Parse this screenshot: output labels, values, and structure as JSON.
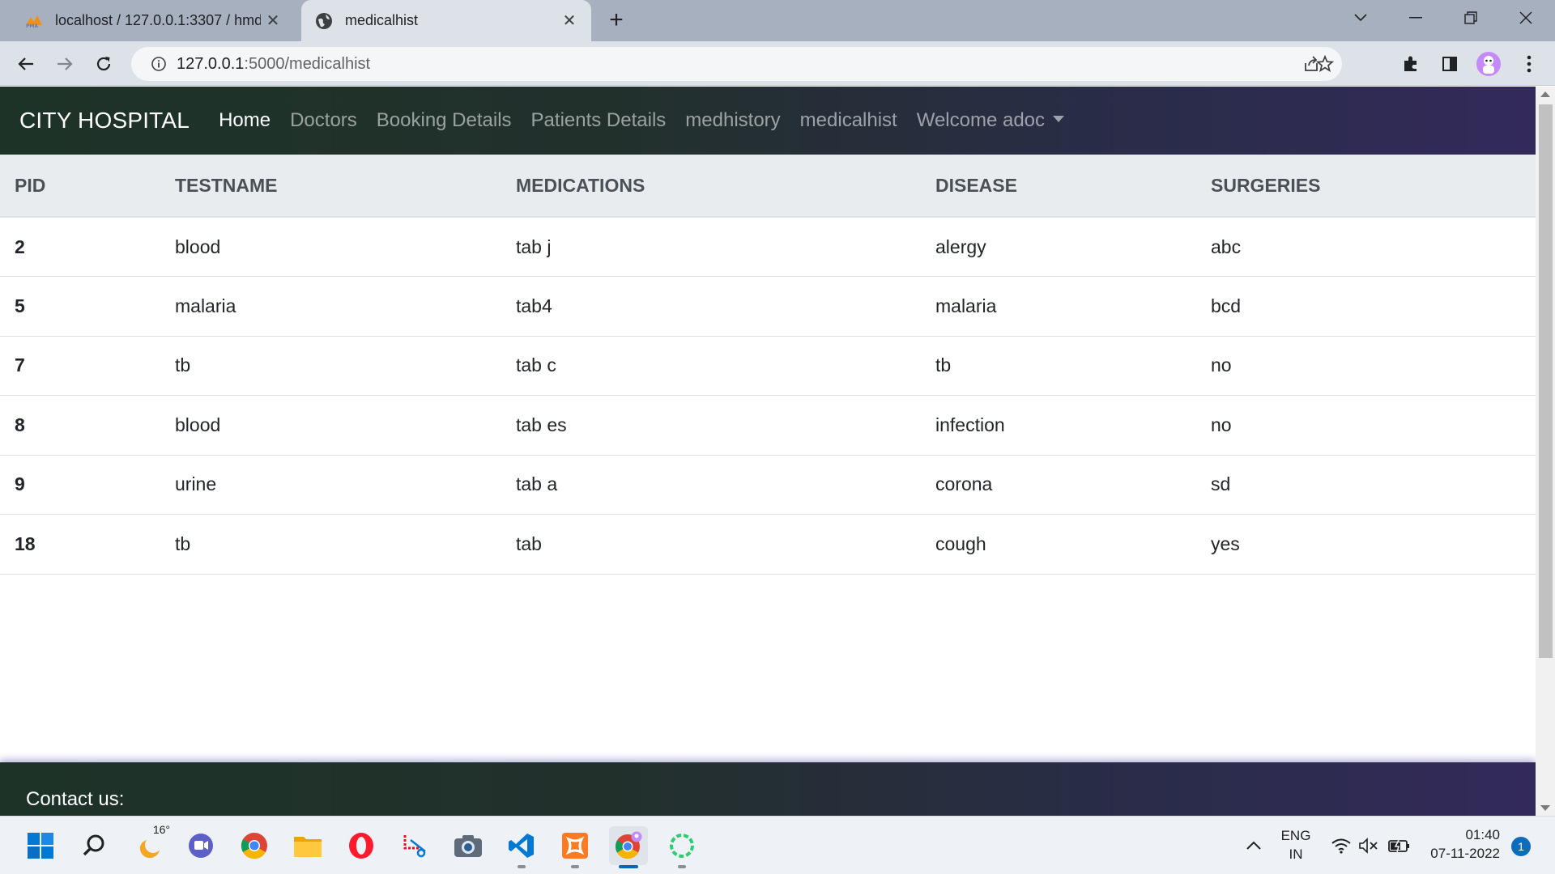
{
  "browser": {
    "tabs": [
      {
        "title": "localhost / 127.0.0.1:3307 / hmdb",
        "icon": "phpmyadmin-icon",
        "active": false
      },
      {
        "title": "medicalhist",
        "icon": "globe-icon",
        "active": true
      }
    ],
    "address": {
      "host": "127.0.0.1",
      "path": ":5000/medicalhist"
    }
  },
  "navbar": {
    "brand": "CITY HOSPITAL",
    "links": [
      "Home",
      "Doctors",
      "Booking Details",
      "Patients Details",
      "medhistory",
      "medicalhist"
    ],
    "user_menu": "Welcome adoc"
  },
  "table": {
    "headers": [
      "PID",
      "TESTNAME",
      "MEDICATIONS",
      "DISEASE",
      "SURGERIES"
    ],
    "rows": [
      [
        "2",
        "blood",
        "tab j",
        "alergy",
        "abc"
      ],
      [
        "5",
        "malaria",
        "tab4",
        "malaria",
        "bcd"
      ],
      [
        "7",
        "tb",
        "tab c",
        "tb",
        "no"
      ],
      [
        "8",
        "blood",
        "tab es",
        "infection",
        "no"
      ],
      [
        "9",
        "urine",
        "tab a",
        "corona",
        "sd"
      ],
      [
        "18",
        "tb",
        "tab",
        "cough",
        "yes"
      ]
    ]
  },
  "footer": {
    "contact": "Contact us:"
  },
  "taskbar": {
    "weather_temp": "16°",
    "lang": "ENG",
    "region": "IN",
    "time": "01:40",
    "date": "07-11-2022",
    "notifications": "1"
  },
  "colors": {
    "navbar_start": "#1d3328",
    "navbar_end": "#332a5a",
    "table_header_bg": "#e9ecef"
  }
}
